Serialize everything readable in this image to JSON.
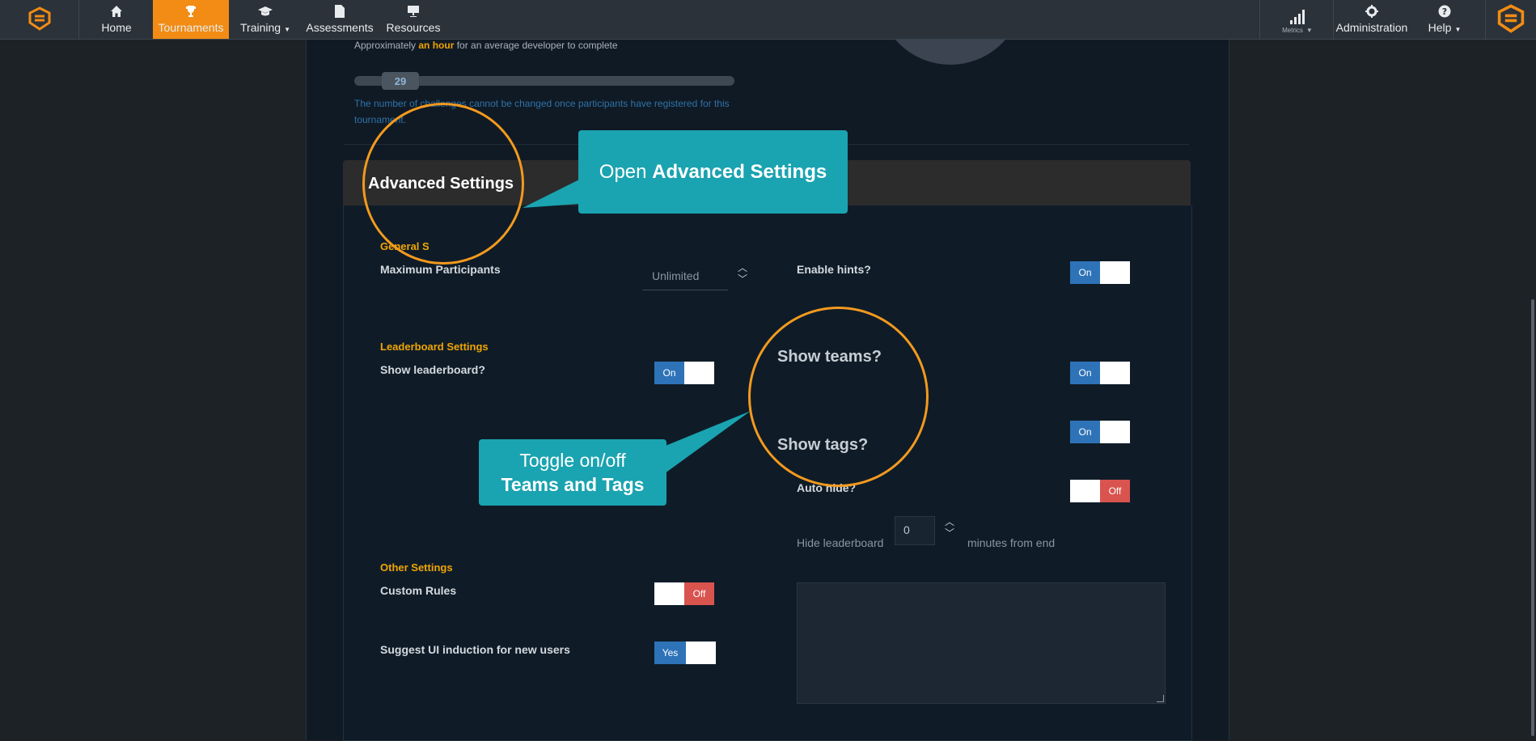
{
  "nav": {
    "home": "Home",
    "tournaments": "Tournaments",
    "training": "Training",
    "assessments": "Assessments",
    "resources": "Resources",
    "metrics": "Metrics",
    "administration": "Administration",
    "help": "Help"
  },
  "challenges": {
    "estimate_prefix": "Approximately",
    "estimate_highlight": "an hour",
    "estimate_suffix": "for an average developer to complete",
    "slider_value": "29",
    "note": "The number of challenges cannot be changed once participants have registered for this tournament."
  },
  "advanced": {
    "title": "Advanced Settings",
    "general_section": "General Settings",
    "max_participants_label": "Maximum Participants",
    "max_participants_placeholder": "Unlimited",
    "enable_hints_label": "Enable hints?",
    "enable_hints_toggle": "On",
    "leaderboard_section": "Leaderboard Settings",
    "show_leaderboard_label": "Show leaderboard?",
    "show_leaderboard_toggle": "On",
    "show_teams_label": "Show teams?",
    "show_teams_toggle": "On",
    "show_tags_label": "Show tags?",
    "show_tags_toggle": "On",
    "auto_hide_label": "Auto hide?",
    "auto_hide_toggle": "Off",
    "hide_leaderboard_label": "Hide leaderboard",
    "hide_leaderboard_value": "0",
    "minutes_from_end": "minutes from end",
    "other_section": "Other Settings",
    "custom_rules_label": "Custom Rules",
    "custom_rules_toggle": "Off",
    "suggest_ui_label": "Suggest UI induction for new users",
    "suggest_ui_toggle": "Yes"
  },
  "annotations": {
    "callout1_prefix": "Open",
    "callout1_bold": "Advanced Settings",
    "callout2_line1": "Toggle on/off",
    "callout2_line2": "Teams and Tags"
  },
  "colors": {
    "accent": "#f28c14",
    "callout": "#1aa3b0",
    "toggle_on": "#2e73b8",
    "toggle_off": "#d9534f",
    "section_heading": "#f0a500"
  }
}
